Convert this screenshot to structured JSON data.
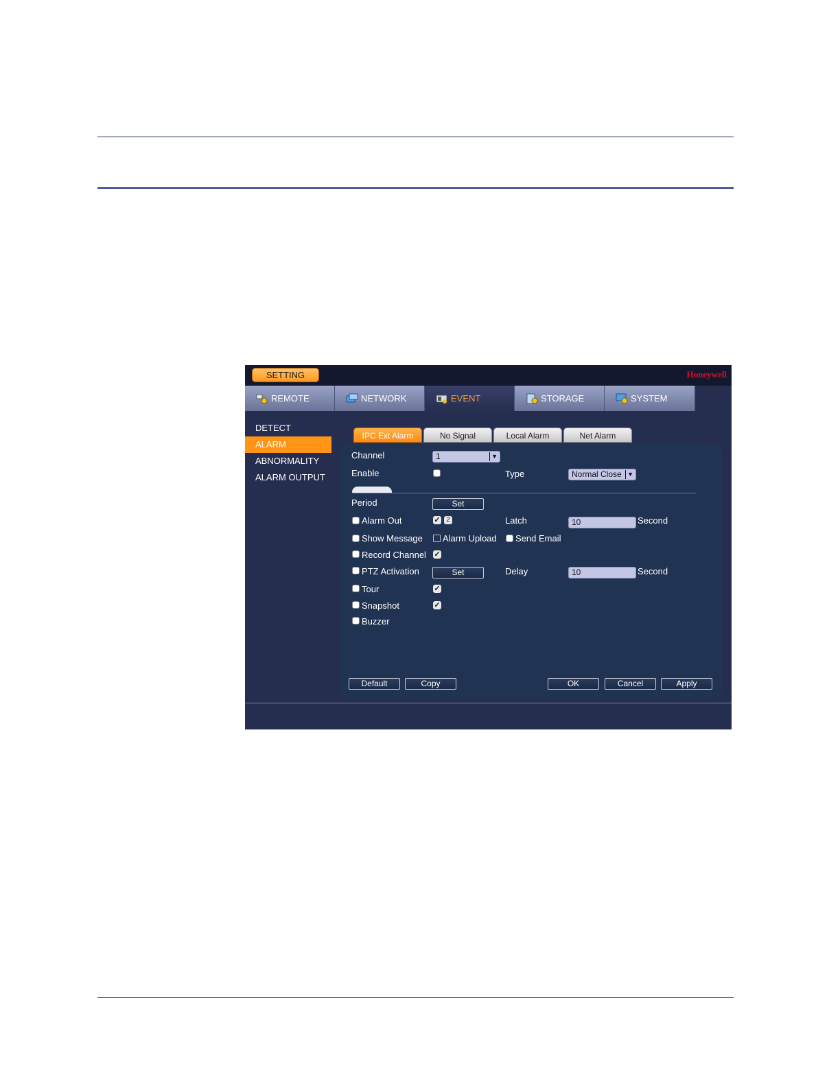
{
  "window": {
    "setting_label": "SETTING",
    "brand": "Honeywell"
  },
  "mainnav": {
    "tabs": [
      {
        "label": "REMOTE",
        "icon": "remote-icon"
      },
      {
        "label": "NETWORK",
        "icon": "network-icon"
      },
      {
        "label": "EVENT",
        "icon": "event-icon",
        "active": true
      },
      {
        "label": "STORAGE",
        "icon": "storage-icon"
      },
      {
        "label": "SYSTEM",
        "icon": "system-icon"
      }
    ]
  },
  "sidebar": {
    "items": [
      {
        "label": "DETECT"
      },
      {
        "label": "ALARM",
        "active": true
      },
      {
        "label": "ABNORMALITY"
      },
      {
        "label": "ALARM OUTPUT"
      }
    ]
  },
  "subtabs": [
    {
      "label": "IPC Ext Alarm",
      "active": true
    },
    {
      "label": "No Signal"
    },
    {
      "label": "Local Alarm"
    },
    {
      "label": "Net Alarm"
    }
  ],
  "form": {
    "channel": {
      "label": "Channel",
      "value": "1"
    },
    "enable": {
      "label": "Enable"
    },
    "type": {
      "label": "Type",
      "value": "Normal Close"
    },
    "period": {
      "label": "Period",
      "button": "Set"
    },
    "alarm_out": {
      "label": "Alarm Out",
      "badge": "2"
    },
    "latch": {
      "label": "Latch",
      "value": "10",
      "unit": "Second"
    },
    "show_message": {
      "label": "Show Message"
    },
    "alarm_upload": {
      "label": "Alarm Upload"
    },
    "send_email": {
      "label": "Send Email"
    },
    "record_channel": {
      "label": "Record Channel"
    },
    "ptz_activation": {
      "label": "PTZ Activation",
      "button": "Set"
    },
    "delay": {
      "label": "Delay",
      "value": "10",
      "unit": "Second"
    },
    "tour": {
      "label": "Tour"
    },
    "snapshot": {
      "label": "Snapshot"
    },
    "buzzer": {
      "label": "Buzzer"
    }
  },
  "buttons": {
    "default": "Default",
    "copy": "Copy",
    "ok": "OK",
    "cancel": "Cancel",
    "apply": "Apply"
  },
  "colors": {
    "accent": "#ff9416",
    "brand": "#d0112b",
    "background": "#262e50",
    "panel": "#203352"
  }
}
